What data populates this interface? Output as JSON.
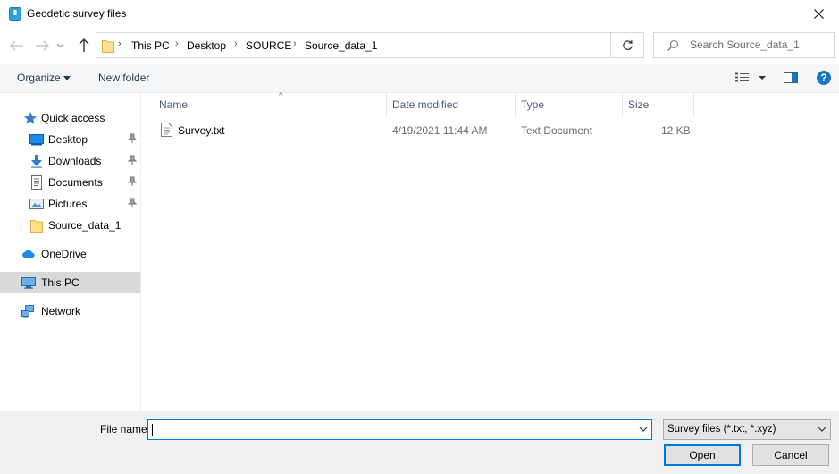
{
  "window": {
    "title": "Geodetic survey files",
    "app_icon": "document-folder-icon",
    "close_icon": "close-icon"
  },
  "navigation": {
    "back_icon": "arrow-left-icon",
    "forward_icon": "arrow-right-icon",
    "recent_icon": "chevron-down-icon",
    "up_icon": "arrow-up-icon",
    "breadcrumbs": [
      "This PC",
      "Desktop",
      "SOURCE",
      "Source_data_1"
    ],
    "separator": "›",
    "refresh_icon": "refresh-icon",
    "search_placeholder": "Search Source_data_1"
  },
  "toolbar": {
    "organize_label": "Organize",
    "new_folder_label": "New folder",
    "view_icon": "view-details-icon",
    "preview_icon": "preview-pane-icon",
    "help_label": "?"
  },
  "sidebar": {
    "items": [
      {
        "label": "Quick access",
        "icon": "star-icon",
        "pinned": false
      },
      {
        "label": "Desktop",
        "icon": "desktop-icon",
        "pinned": true
      },
      {
        "label": "Downloads",
        "icon": "download-icon",
        "pinned": true
      },
      {
        "label": "Documents",
        "icon": "documents-icon",
        "pinned": true
      },
      {
        "label": "Pictures",
        "icon": "pictures-icon",
        "pinned": true
      },
      {
        "label": "Source_data_1",
        "icon": "folder-icon",
        "pinned": false
      },
      {
        "label": "OneDrive",
        "icon": "cloud-icon",
        "pinned": false
      },
      {
        "label": "This PC",
        "icon": "computer-icon",
        "pinned": false,
        "selected": true
      },
      {
        "label": "Network",
        "icon": "network-icon",
        "pinned": false
      }
    ]
  },
  "columns": {
    "name": "Name",
    "date_modified": "Date modified",
    "type": "Type",
    "size": "Size",
    "sort_indicator": "^"
  },
  "files": [
    {
      "name": "Survey.txt",
      "date_modified": "4/19/2021 11:44 AM",
      "type": "Text Document",
      "size": "12 KB",
      "icon": "text-file-icon"
    }
  ],
  "footer": {
    "file_name_label": "File name:",
    "file_name_value": "",
    "filter_label": "Survey files (*.txt, *.xyz)",
    "open_label": "Open",
    "cancel_label": "Cancel"
  },
  "colors": {
    "accent": "#0078d7",
    "selected_bg": "#d9d9d9",
    "footer_bg": "#f0f0f0",
    "column_header_text": "#4c607a",
    "toolbar_text": "#1e395b",
    "help_blue": "#1975c5"
  }
}
